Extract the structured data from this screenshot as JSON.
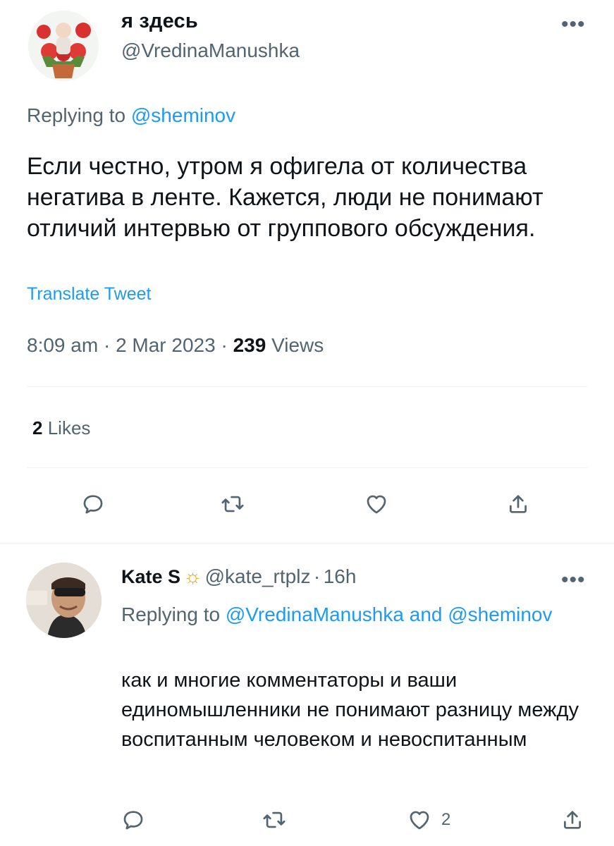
{
  "main_tweet": {
    "display_name": "я здесь",
    "handle": "@VredinaManushka",
    "replying_prefix": "Replying to",
    "replying_to": "@sheminov",
    "text": "Если честно, утром я офигела от количества негатива в ленте. Кажется, люди не понимают отличий интервью от группового обсуждения.",
    "translate_label": "Translate Tweet",
    "time": "8:09 am",
    "date": "2 Mar 2023",
    "sep": "·",
    "views_count": "239",
    "views_label": "Views",
    "likes_count": "2",
    "likes_label": "Likes",
    "more_icon": "more-dots-icon"
  },
  "reply_tweet": {
    "display_name": "Kate S",
    "emoji": "☼",
    "handle": "@kate_rtplz",
    "sep": "·",
    "time_ago": "16h",
    "replying_prefix": "Replying to",
    "replying_to_1": "@VredinaManushka",
    "and_label": "and",
    "replying_to_2": "@sheminov",
    "text": "как и многие комментаторы и ваши единомышленники не понимают разницу между воспитанным человеком и невоспитанным",
    "like_count": "2"
  },
  "colors": {
    "text": "#0f1419",
    "secondary": "#536471",
    "accent": "#1d9bf0",
    "divider": "#eff3f4"
  }
}
